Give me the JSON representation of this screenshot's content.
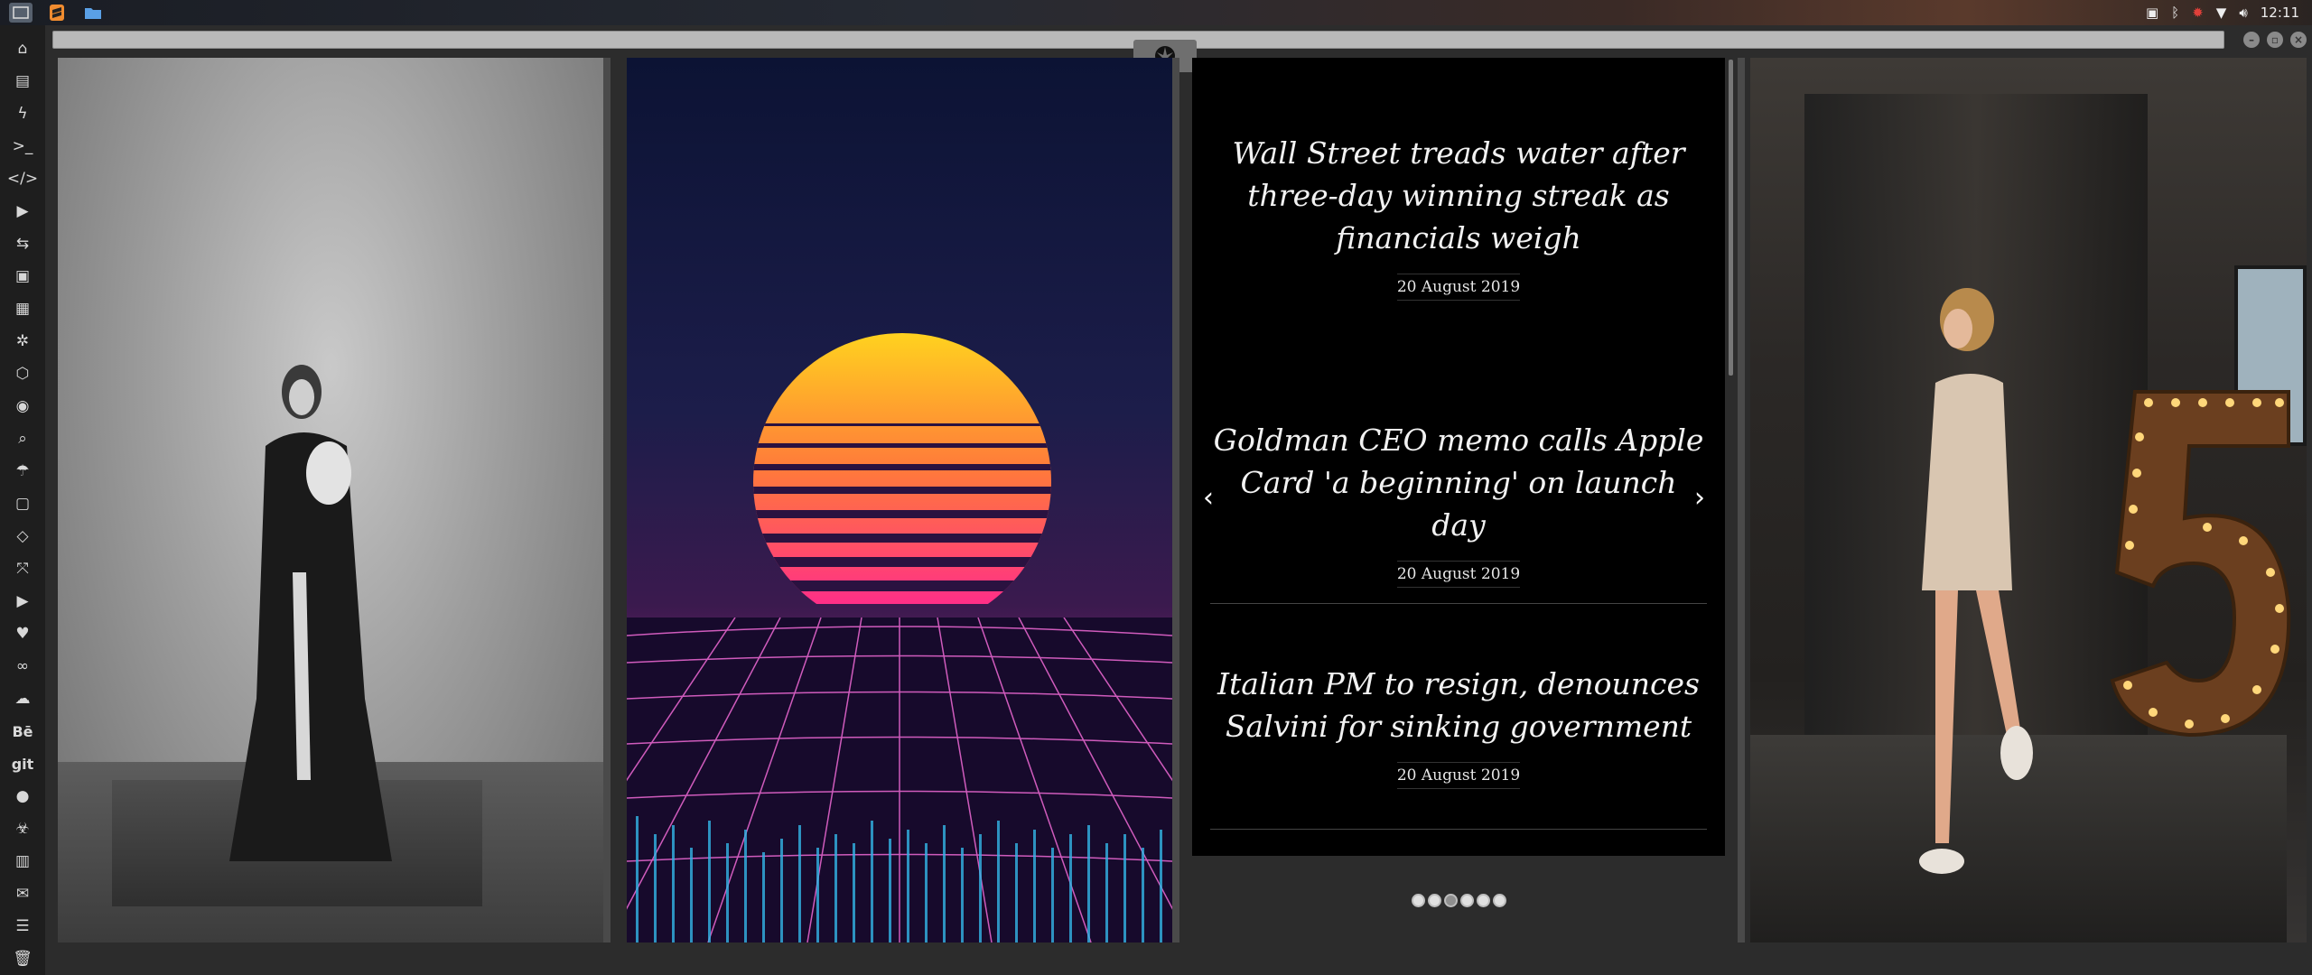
{
  "system": {
    "clock": "12:11",
    "launcher": [
      {
        "name": "show-desktop",
        "icon": "desktop-icon"
      },
      {
        "name": "sublime",
        "icon": "sublime-icon"
      },
      {
        "name": "files",
        "icon": "folder-icon"
      }
    ],
    "tray_icons": [
      "screenshot-icon",
      "bluetooth-icon",
      "update-icon",
      "wifi-icon",
      "volume-icon"
    ]
  },
  "dock": {
    "items": [
      {
        "icon": "home-icon",
        "glyph": "⌂"
      },
      {
        "icon": "document-icon",
        "glyph": "▤"
      },
      {
        "icon": "bolt-icon",
        "glyph": "ϟ"
      },
      {
        "icon": "terminal-icon",
        "glyph": ">_"
      },
      {
        "icon": "code-icon",
        "glyph": "</>"
      },
      {
        "icon": "play-icon",
        "glyph": "▶"
      },
      {
        "icon": "translate-icon",
        "glyph": "⇆"
      },
      {
        "icon": "image-icon",
        "glyph": "▣"
      },
      {
        "icon": "news-icon",
        "glyph": "▦"
      },
      {
        "icon": "aperture-icon",
        "glyph": "✲"
      },
      {
        "icon": "hexagon-icon",
        "glyph": "⬡"
      },
      {
        "icon": "globe-icon",
        "glyph": "◉"
      },
      {
        "icon": "search-icon",
        "glyph": "⌕"
      },
      {
        "icon": "umbrella-icon",
        "glyph": "☂"
      },
      {
        "icon": "contact-icon",
        "glyph": "▢"
      },
      {
        "icon": "tag-icon",
        "glyph": "◇"
      },
      {
        "icon": "expand-icon",
        "glyph": "⤧"
      },
      {
        "icon": "youtube-icon",
        "glyph": "▶"
      },
      {
        "icon": "heart-icon",
        "glyph": "♥"
      },
      {
        "icon": "infinity-icon",
        "glyph": "∞"
      },
      {
        "icon": "cloud-icon",
        "glyph": "☁"
      },
      {
        "icon": "behance-icon",
        "text": "Bē"
      },
      {
        "icon": "git-icon",
        "text": "git"
      },
      {
        "icon": "github-icon",
        "glyph": "●"
      },
      {
        "icon": "biohazard-icon",
        "glyph": "☣"
      },
      {
        "icon": "map-icon",
        "glyph": "▥"
      },
      {
        "icon": "mail-icon",
        "glyph": "✉"
      },
      {
        "icon": "server-icon",
        "glyph": "☰"
      },
      {
        "icon": "trash-icon",
        "glyph": "🗑"
      }
    ]
  },
  "window": {
    "tab_icon": "rebel-alliance-icon",
    "controls": [
      "minimize",
      "maximize",
      "close"
    ]
  },
  "news": {
    "slides": [
      {
        "headline": "Wall Street treads water after three-day winning streak as financials weigh",
        "date": "20 August 2019"
      },
      {
        "headline": "Goldman CEO memo calls Apple Card 'a beginning' on launch day",
        "date": "20 August 2019"
      },
      {
        "headline": "Italian PM to resign, denounces Salvini for sinking government",
        "date": "20 August 2019"
      }
    ],
    "prev_label": "‹",
    "next_label": "›",
    "pager_count": 6,
    "pager_active": 3
  }
}
